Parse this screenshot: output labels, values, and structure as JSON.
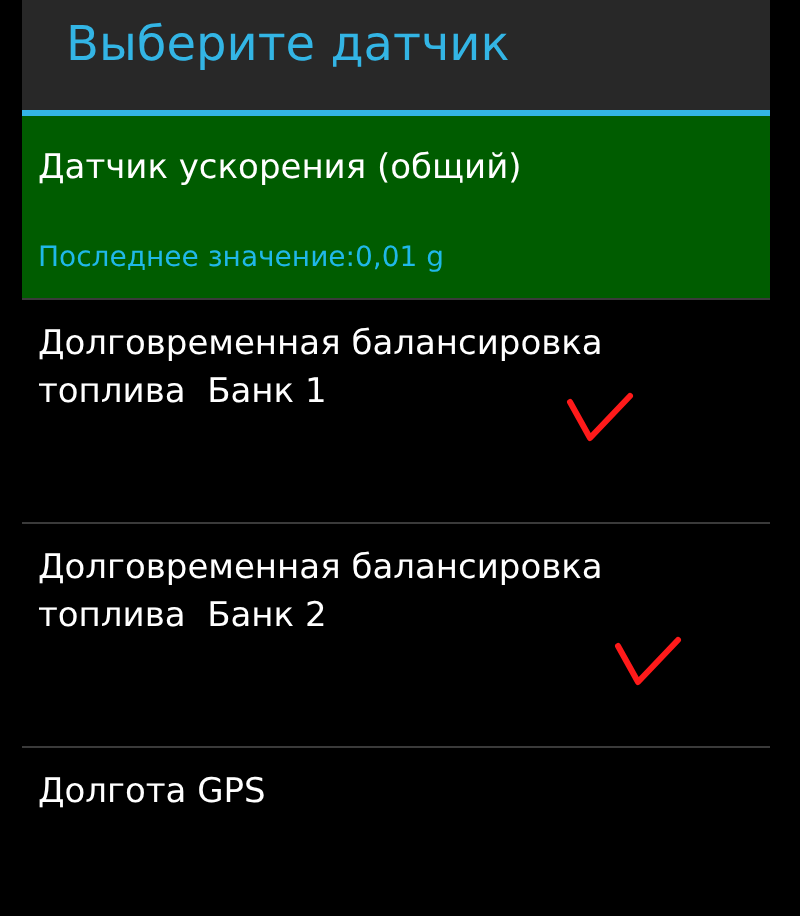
{
  "dialog": {
    "title": "Выберите датчик"
  },
  "items": [
    {
      "name": "Датчик ускорения (общий)",
      "subtitle": "Последнее значение:0,01 g",
      "selected": true,
      "marked": false
    },
    {
      "name": "Долговременная балансировка топлива  Банк 1",
      "selected": false,
      "marked": true
    },
    {
      "name": "Долговременная балансировка топлива  Банк 2",
      "selected": false,
      "marked": true
    },
    {
      "name": "Долгота GPS",
      "selected": false,
      "marked": false
    }
  ]
}
